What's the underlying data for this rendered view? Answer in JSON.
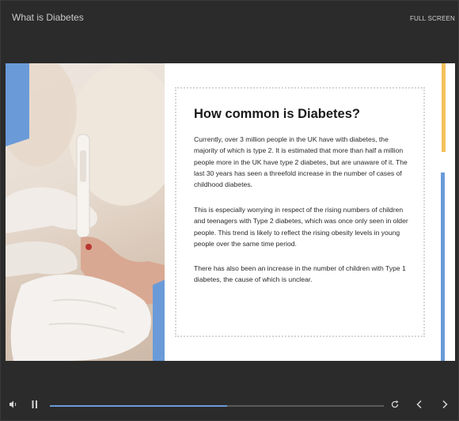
{
  "header": {
    "title": "What is Diabetes",
    "fullscreen_label": "FULL SCREEN"
  },
  "slide": {
    "heading": "How common is Diabetes?",
    "paragraphs": [
      "Currently, over 3 million people in the UK have with diabetes, the majority of which is type 2. It is estimated that more than half a million people more in the UK have type 2 diabetes, but are unaware of it. The last 30 years has seen a threefold increase in the number of cases of childhood diabetes.",
      "This is especially worrying in respect of the rising numbers of children and teenagers with Type 2 diabetes, which was once only seen in older people. This trend is likely to reflect the rising obesity levels in young people over the same time period.",
      "There has also been an increase in the number of children with Type 1 diabetes, the cause of which is unclear."
    ],
    "accent_colors": {
      "blue": "#6a9bd8",
      "yellow": "#f3c15a"
    }
  },
  "controls": {
    "volume_icon": "volume-icon",
    "pause_icon": "pause-icon",
    "replay_icon": "replay-icon",
    "prev_icon": "chevron-left-icon",
    "next_icon": "chevron-right-icon",
    "progress_fraction": 0.53
  }
}
